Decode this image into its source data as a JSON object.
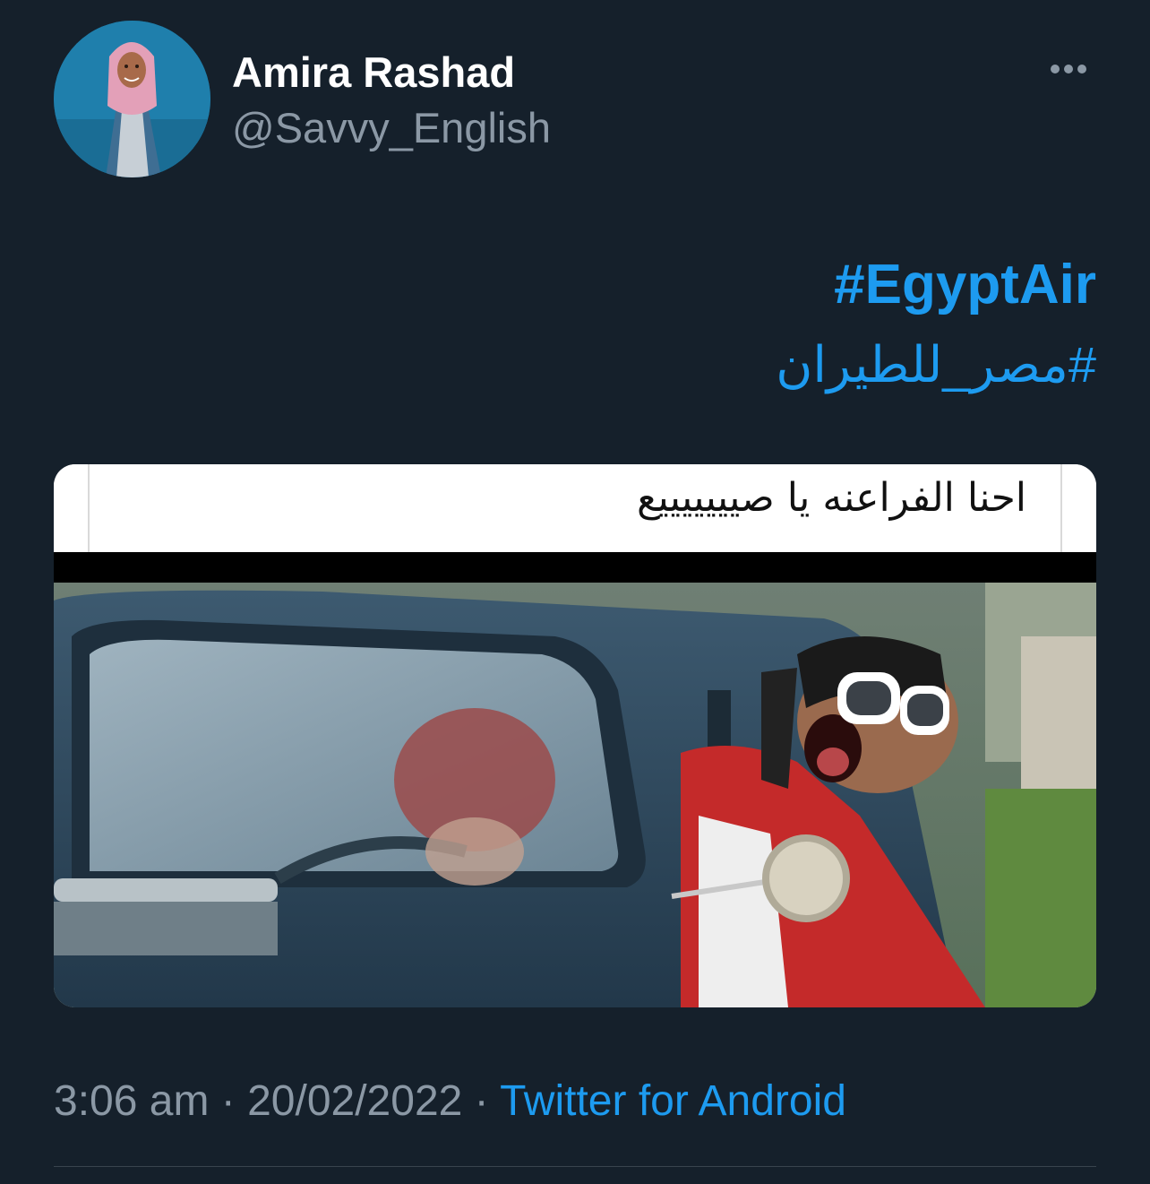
{
  "author": {
    "name": "Amira Rashad",
    "handle": "@Savvy_English"
  },
  "tweet": {
    "hashtags": [
      "#EgyptAir",
      "#مصر_للطيران"
    ],
    "media": {
      "caption": "احنا الفراعنه يا صيييييييع"
    },
    "meta": {
      "time": "3:06 am",
      "separator": " · ",
      "date": "20/02/2022",
      "source": "Twitter for Android"
    }
  },
  "icons": {
    "more": "more-horizontal-icon"
  },
  "colors": {
    "background": "#15202b",
    "link": "#1d9bf0",
    "secondary_text": "#8b98a5",
    "divider": "#38444d"
  }
}
